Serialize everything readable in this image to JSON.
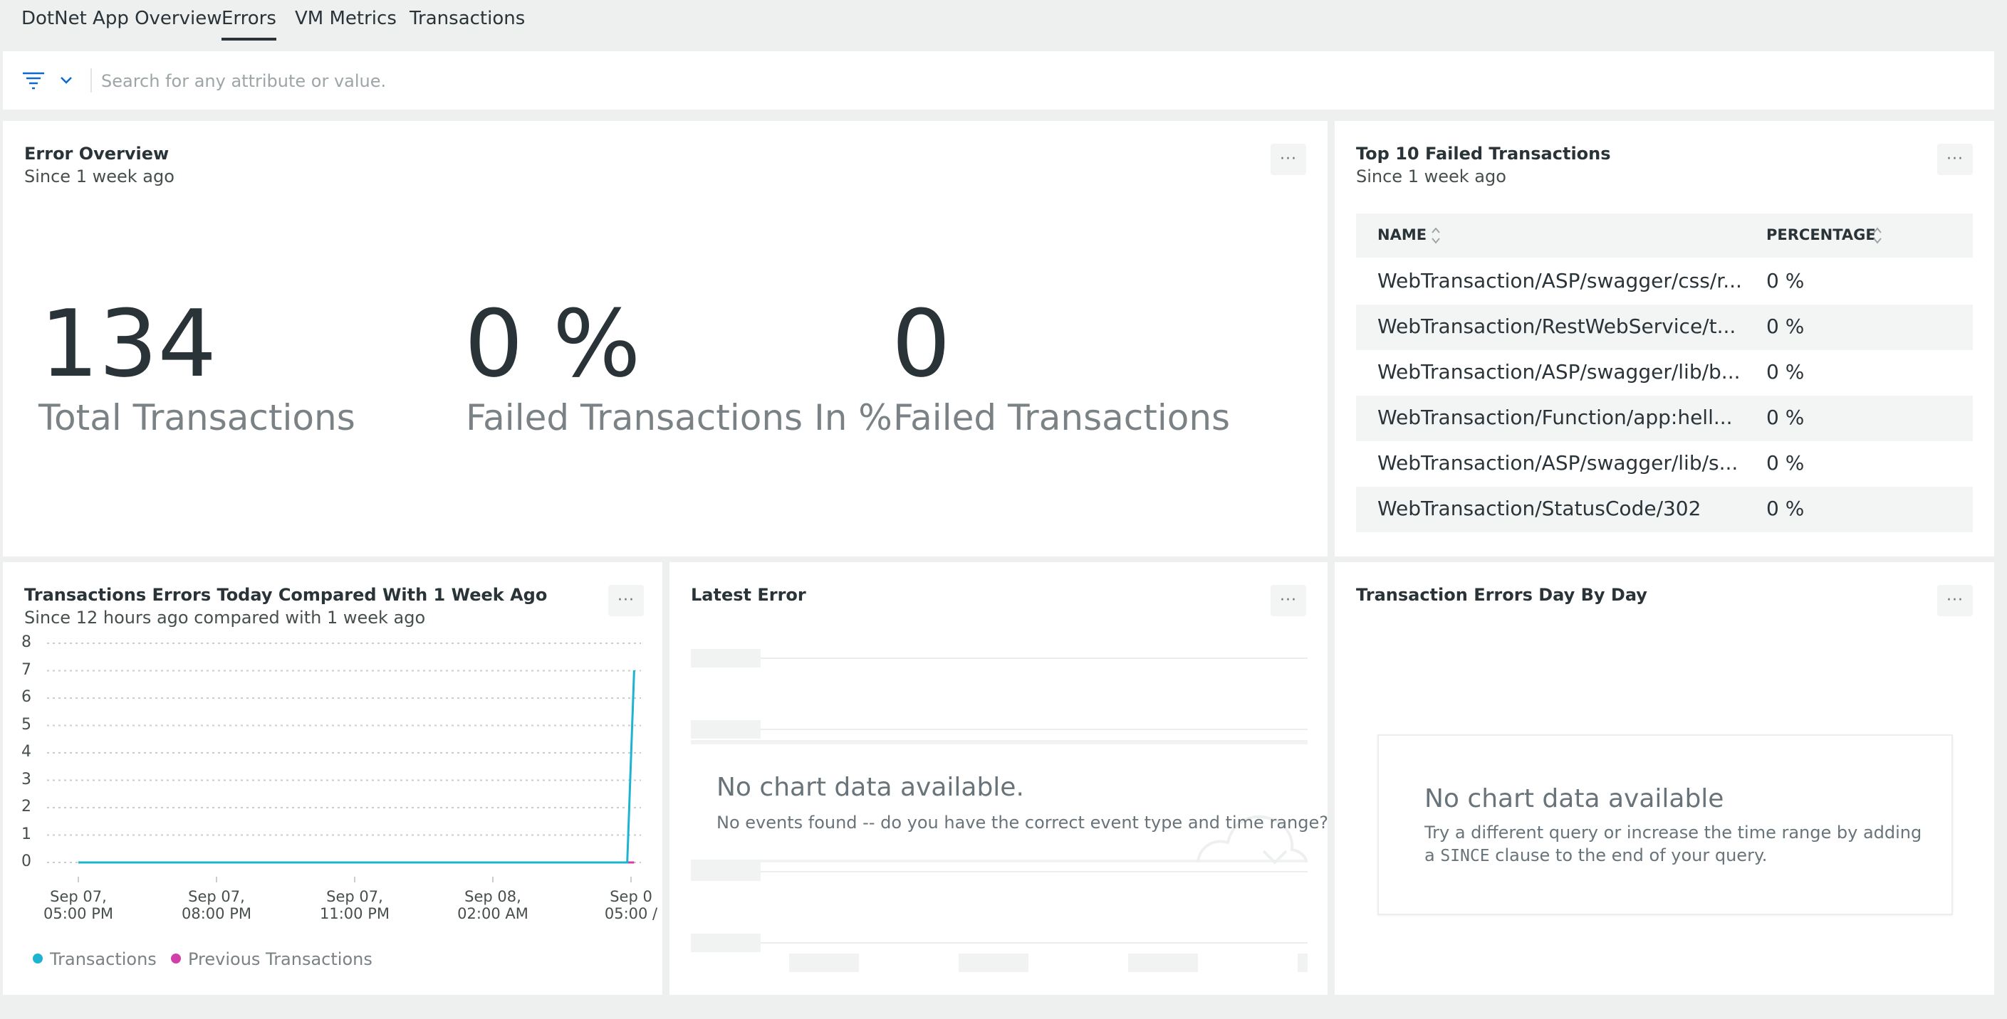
{
  "tabs": [
    {
      "label": "DotNet App Overview",
      "active": false
    },
    {
      "label": "Errors",
      "active": true
    },
    {
      "label": "VM Metrics",
      "active": false
    },
    {
      "label": "Transactions",
      "active": false
    }
  ],
  "filter": {
    "placeholder": "Search for any attribute or value.",
    "filter_icon": "filter-icon",
    "dropdown_icon": "chevron-down-icon"
  },
  "error_overview": {
    "title": "Error Overview",
    "subtitle": "Since 1 week ago",
    "metrics": [
      {
        "value": "134",
        "label": "Total Transactions"
      },
      {
        "value": "0 %",
        "label": "Failed Transactions In %"
      },
      {
        "value": "0",
        "label": "Failed Transactions"
      }
    ]
  },
  "top_failed": {
    "title": "Top 10 Failed Transactions",
    "subtitle": "Since 1 week ago",
    "columns": [
      "NAME",
      "PERCENTAGE"
    ],
    "rows": [
      {
        "name": "WebTransaction/ASP/swagger/css/r...",
        "percentage": "0 %"
      },
      {
        "name": "WebTransaction/RestWebService/t...",
        "percentage": "0 %"
      },
      {
        "name": "WebTransaction/ASP/swagger/lib/b...",
        "percentage": "0 %"
      },
      {
        "name": "WebTransaction/Function/app:hell...",
        "percentage": "0 %"
      },
      {
        "name": "WebTransaction/ASP/swagger/lib/s...",
        "percentage": "0 %"
      },
      {
        "name": "WebTransaction/StatusCode/302",
        "percentage": "0 %"
      }
    ]
  },
  "errors_compare": {
    "title": "Transactions Errors Today Compared With 1 Week Ago",
    "subtitle": "Since 12 hours ago compared with 1 week ago",
    "legend": [
      {
        "name": "Transactions",
        "color": "#1eb3d1"
      },
      {
        "name": "Previous Transactions",
        "color": "#d13fa8"
      }
    ]
  },
  "latest_error": {
    "title": "Latest Error",
    "empty_title": "No chart data available.",
    "empty_message": "No events found -- do you have the correct event type and time range?"
  },
  "day_by_day": {
    "title": "Transaction Errors Day By Day",
    "empty_title": "No chart data available",
    "empty_message_before": "Try a different query or increase the time range by adding a",
    "empty_keyword": "SINCE",
    "empty_message_after": "clause to the end of your query."
  },
  "chart_data": {
    "type": "line",
    "title": "Transactions Errors Today Compared With 1 Week Ago",
    "ylim": [
      0,
      8
    ],
    "yticks": [
      "0",
      "1",
      "2",
      "3",
      "4",
      "5",
      "6",
      "7",
      "8"
    ],
    "x_ticks": [
      {
        "line1": "Sep 07,",
        "line2": "05:00 PM"
      },
      {
        "line1": "Sep 07,",
        "line2": "08:00 PM"
      },
      {
        "line1": "Sep 07,",
        "line2": "11:00 PM"
      },
      {
        "line1": "Sep 08,",
        "line2": "02:00 AM"
      },
      {
        "line1": "Sep 0",
        "line2": "05:00 /"
      }
    ],
    "x_range_hours": [
      0,
      12.3
    ],
    "series": [
      {
        "name": "Transactions",
        "color": "#1eb3d1",
        "points": [
          [
            0,
            0
          ],
          [
            12.0,
            0
          ],
          [
            12.0,
            0
          ],
          [
            12.15,
            7.5
          ]
        ]
      },
      {
        "name": "Previous Transactions",
        "color": "#d13fa8",
        "points": [
          [
            0,
            0
          ],
          [
            12.15,
            0
          ]
        ]
      }
    ]
  }
}
